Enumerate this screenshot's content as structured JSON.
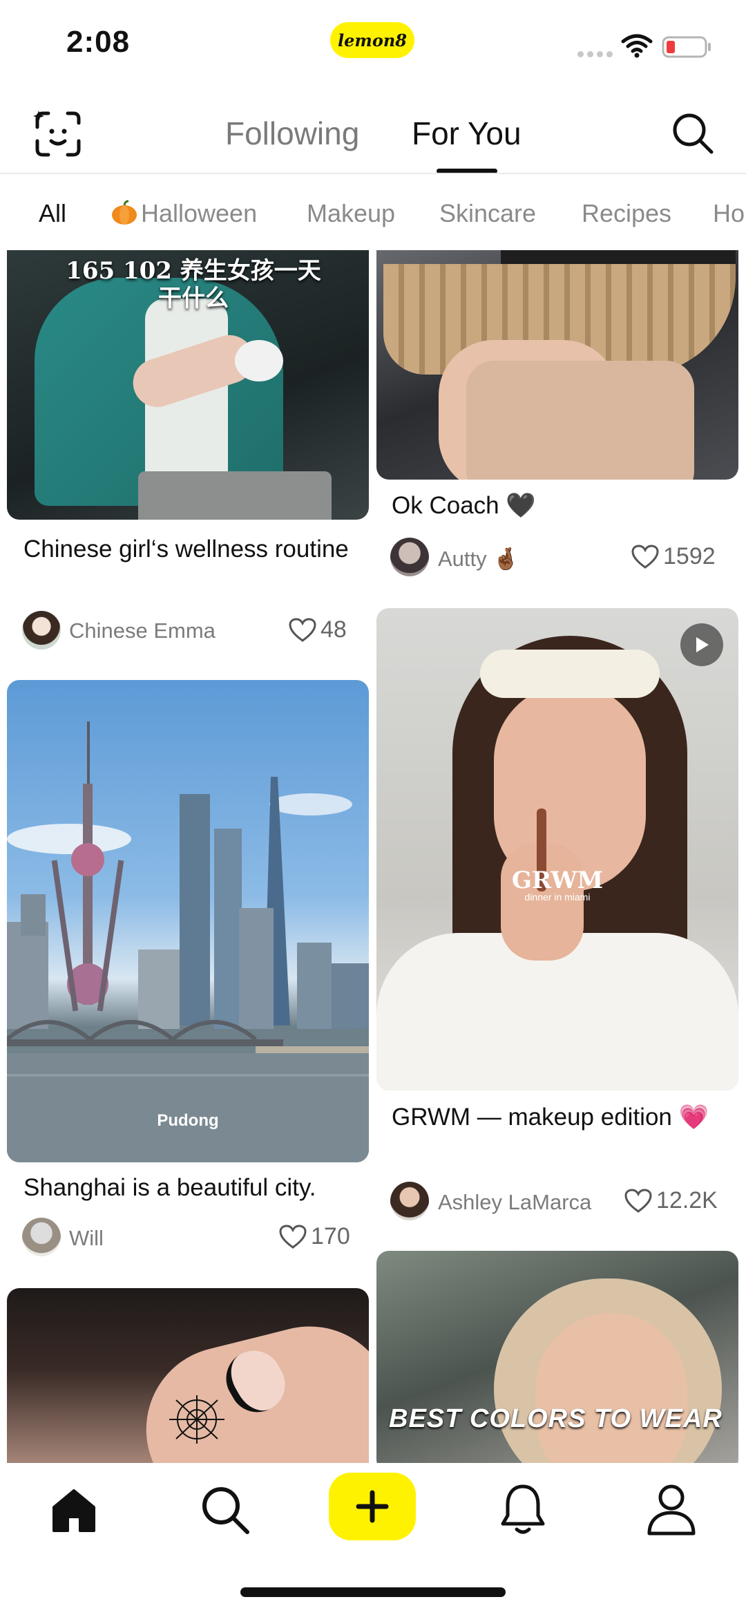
{
  "status_bar": {
    "time": "2:08",
    "brand_badge": "lemon8",
    "icons": [
      "signal-dots-icon",
      "wifi-icon",
      "battery-low-icon"
    ]
  },
  "header": {
    "tabs": [
      {
        "label": "Following",
        "active": false
      },
      {
        "label": "For You",
        "active": true
      }
    ],
    "left_icon": "face-scan-icon",
    "right_icon": "search-icon"
  },
  "categories": [
    {
      "label": "All",
      "active": true
    },
    {
      "label": "Halloween",
      "icon": "pumpkin-icon"
    },
    {
      "label": "Makeup"
    },
    {
      "label": "Skincare"
    },
    {
      "label": "Recipes"
    },
    {
      "label": "Ho"
    }
  ],
  "feed": {
    "left": [
      {
        "title": "Chinese girl‘s wellness routine",
        "image_text": "165 102 养生女孩一天干什么",
        "author": "Chinese Emma",
        "likes": "48"
      },
      {
        "title": "Shanghai is a beautiful city.",
        "image_text": "Pudong",
        "author": "Will",
        "likes": "170"
      },
      {
        "title": "",
        "image_text": "",
        "author": "",
        "likes": ""
      }
    ],
    "right": [
      {
        "title": "Ok Coach 🖤",
        "author": "Autty 🤞🏾",
        "likes": "1592"
      },
      {
        "title": "GRWM — makeup edition 💗",
        "image_text": "GRWM",
        "image_subtext": "dinner in miami",
        "author": "Ashley LaMarca",
        "likes": "12.2K"
      },
      {
        "title": "",
        "image_text": "BEST COLORS TO WEAR",
        "author": "",
        "likes": ""
      }
    ]
  },
  "tab_bar": {
    "items": [
      "home-icon",
      "search-icon",
      "plus-icon",
      "bell-icon",
      "profile-icon"
    ]
  },
  "colors": {
    "brand_yellow": "#fff200",
    "text_primary": "#111111",
    "text_secondary": "#7a7a7a"
  }
}
